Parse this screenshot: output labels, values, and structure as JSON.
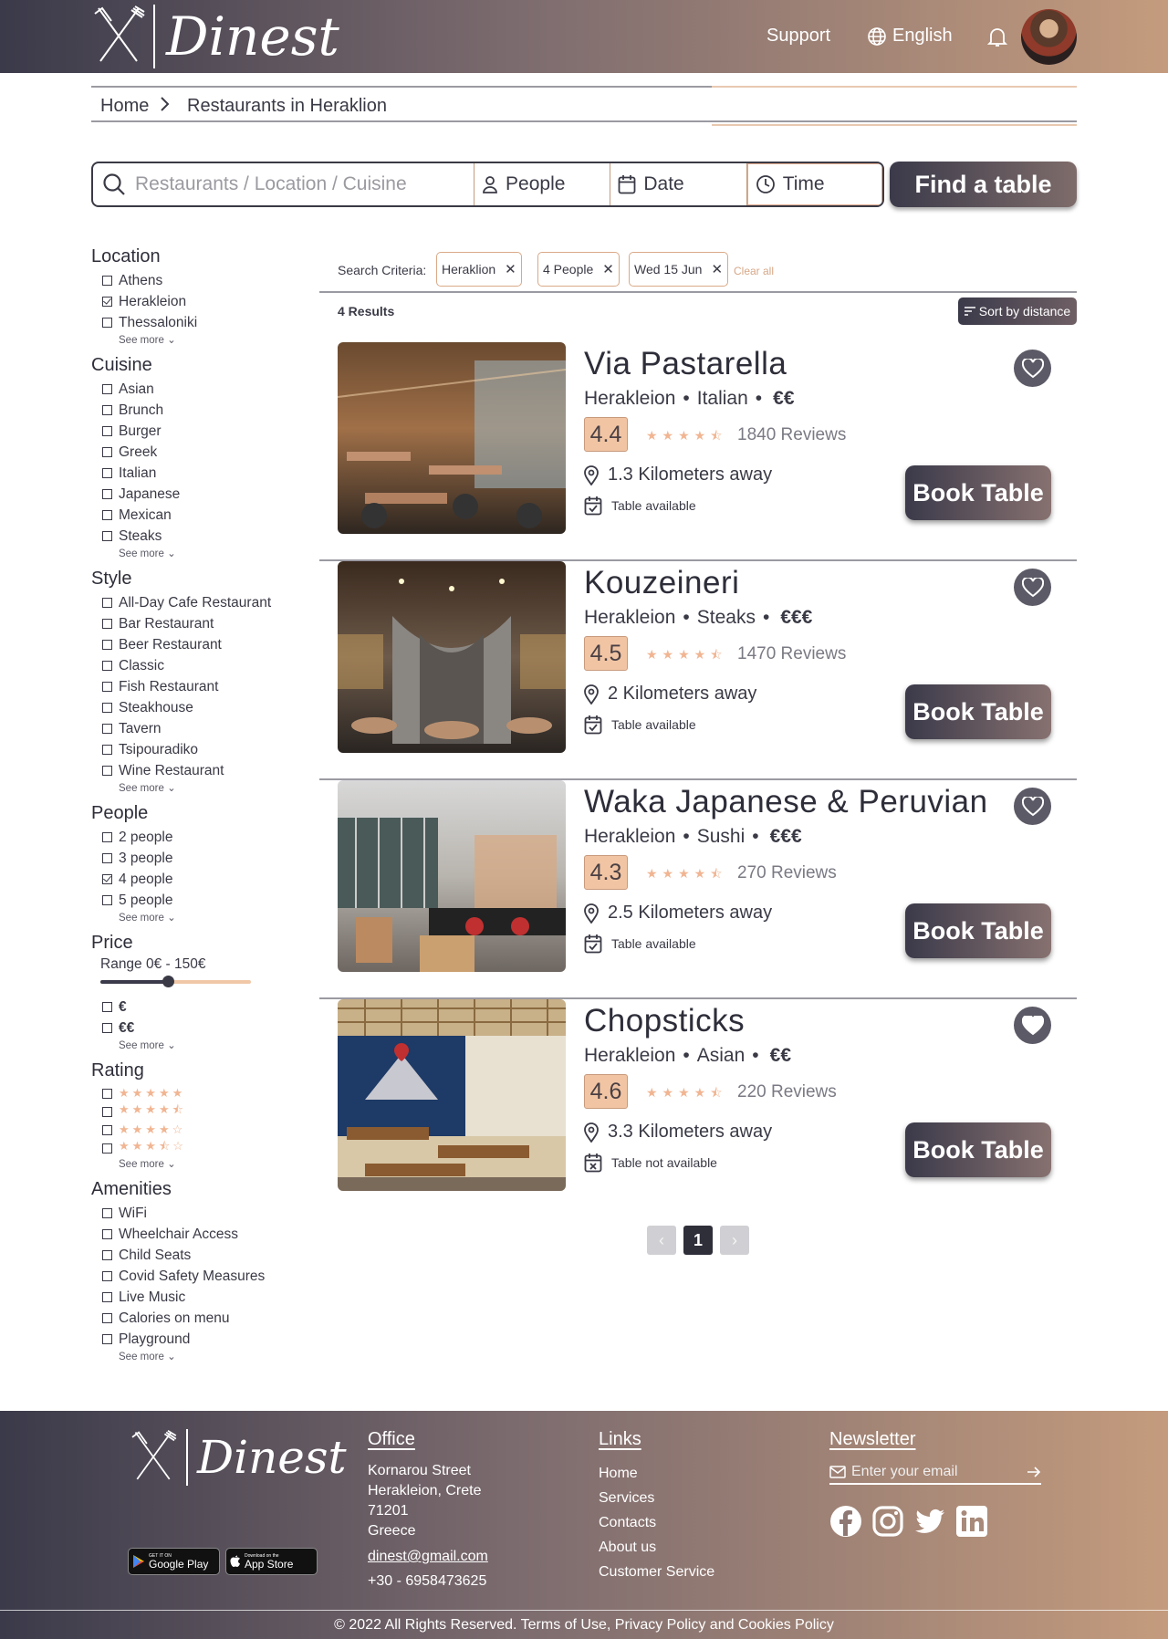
{
  "brand": {
    "name": "Dinest"
  },
  "header": {
    "support": "Support",
    "language": "English"
  },
  "breadcrumb": {
    "home": "Home",
    "current": "Restaurants in Heraklion"
  },
  "search": {
    "placeholder": "Restaurants / Location / Cuisine",
    "people": "People",
    "date": "Date",
    "time": "Time",
    "find_label": "Find a table"
  },
  "filters": {
    "location": {
      "title": "Location",
      "options": [
        "Athens",
        "Herakleion",
        "Thessaloniki"
      ],
      "checked": [
        "Herakleion"
      ],
      "see_more": "See more"
    },
    "cuisine": {
      "title": "Cuisine",
      "options": [
        "Asian",
        "Brunch",
        "Burger",
        "Greek",
        "Italian",
        "Japanese",
        "Mexican",
        "Steaks"
      ],
      "see_more": "See more"
    },
    "style": {
      "title": "Style",
      "options": [
        "All-Day Cafe Restaurant",
        "Bar Restaurant",
        "Beer Restaurant",
        "Classic",
        "Fish Restaurant",
        "Steakhouse",
        "Tavern",
        "Tsipouradiko",
        "Wine Restaurant"
      ],
      "see_more": "See more"
    },
    "people": {
      "title": "People",
      "options": [
        "2 people",
        "3 people",
        "4 people",
        "5 people"
      ],
      "checked": [
        "4 people"
      ],
      "see_more": "See more"
    },
    "price": {
      "title": "Price",
      "range_label": "Range 0€ - 150€",
      "slider_value": 0.45,
      "options": [
        "€",
        "€€"
      ],
      "see_more": "See more"
    },
    "rating": {
      "title": "Rating",
      "options": [
        5,
        4.5,
        4,
        3.5
      ],
      "see_more": "See more"
    },
    "amenities": {
      "title": "Amenities",
      "options": [
        "WiFi",
        "Wheelchair Access",
        "Child Seats",
        "Covid Safety Measures",
        "Live Music",
        "Calories on menu",
        "Playground"
      ],
      "see_more": "See more"
    }
  },
  "criteria": {
    "label": "Search Criteria:",
    "chips": [
      "Heraklion",
      "4 People",
      "Wed 15 Jun"
    ],
    "clear_all": "Clear all"
  },
  "results": {
    "count": "4 Results",
    "sort_label": "Sort by distance",
    "book_label": "Book Table",
    "items": [
      {
        "name": "Via Pastarella",
        "city": "Herakleion",
        "cuisine": "Italian",
        "price": "€€",
        "rating": "4.4",
        "stars": 4.5,
        "reviews": "1840 Reviews",
        "distance": "1.3 Kilometers away",
        "availability": "Table available",
        "available": true,
        "favorite": false
      },
      {
        "name": "Kouzeineri",
        "city": "Herakleion",
        "cuisine": "Steaks",
        "price": "€€€",
        "rating": "4.5",
        "stars": 4.5,
        "reviews": "1470 Reviews",
        "distance": "2 Kilometers away",
        "availability": "Table available",
        "available": true,
        "favorite": false
      },
      {
        "name": "Waka Japanese & Peruvian",
        "city": "Herakleion",
        "cuisine": "Sushi",
        "price": "€€€",
        "rating": "4.3",
        "stars": 4.5,
        "reviews": "270 Reviews",
        "distance": "2.5 Kilometers away",
        "availability": "Table available",
        "available": true,
        "favorite": false
      },
      {
        "name": "Chopsticks",
        "city": "Herakleion",
        "cuisine": "Asian",
        "price": "€€",
        "rating": "4.6",
        "stars": 4.5,
        "reviews": "220 Reviews",
        "distance": "3.3 Kilometers away",
        "availability": "Table not available",
        "available": false,
        "favorite": true
      }
    ]
  },
  "pagination": {
    "current": "1",
    "prev": "‹",
    "next": "›"
  },
  "footer": {
    "office_title": "Office",
    "address": [
      "Kornarou Street",
      "Herakleion, Crete",
      "71201",
      "Greece"
    ],
    "email": "dinest@gmail.com",
    "phone": "+30 - 6958473625",
    "links_title": "Links",
    "links": [
      "Home",
      "Services",
      "Contacts",
      "About us",
      "Customer Service"
    ],
    "newsletter_title": "Newsletter",
    "newsletter_placeholder": "Enter your email",
    "google_play_small": "GET IT ON",
    "google_play": "Google Play",
    "app_store_small": "Download on the",
    "app_store": "App Store",
    "copyright": "© 2022 All Rights Reserved. Terms of Use, Privacy Policy and Cookies Policy"
  },
  "colors": {
    "accent": "#c49b7d",
    "dark": "#3b3a4a",
    "peach": "#f1c5a4"
  }
}
